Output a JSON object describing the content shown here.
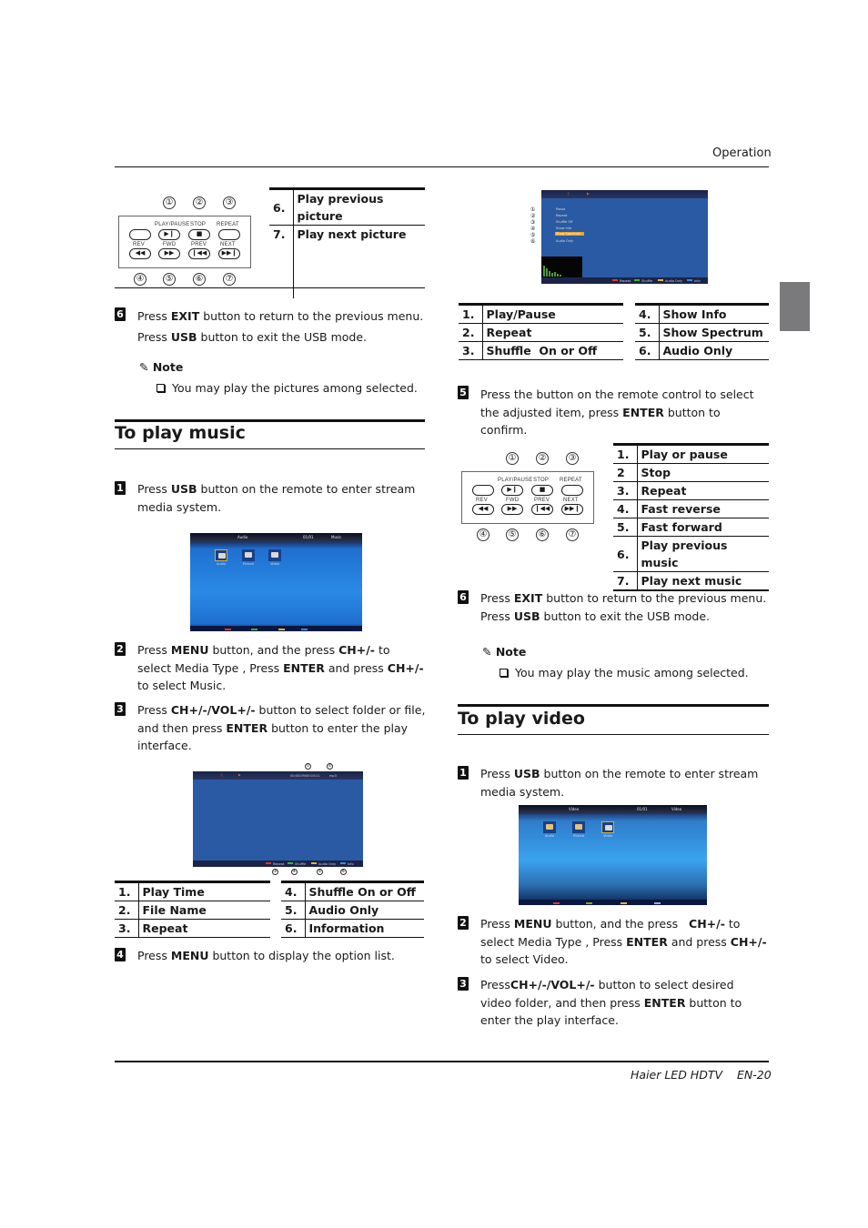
{
  "header": {
    "section": "Operation"
  },
  "footer": {
    "product": "Haier LED HDTV",
    "page": "EN-20"
  },
  "remote_labels": {
    "top_row": [
      "PLAY/PAUSE",
      "STOP",
      "REPEAT"
    ],
    "bottom_row": [
      "REV",
      "FWD",
      "PREV",
      "NEXT"
    ],
    "top_markers": [
      "①",
      "②",
      "③"
    ],
    "bottom_markers": [
      "④",
      "⑤",
      "⑥",
      "⑦"
    ],
    "glyphs": {
      "play_pause": "▶❙",
      "stop": "■",
      "rev": "◀◀",
      "fwd": "▶▶",
      "prev": "❙◀◀",
      "next": "▶▶❙"
    }
  },
  "picture_table": [
    {
      "num": "6.",
      "label": "Play previous picture"
    },
    {
      "num": "7.",
      "label": "Play next picture"
    }
  ],
  "picture_step6": {
    "num": "6",
    "line1_pre": "Press ",
    "line1_bold": "EXIT",
    "line1_post": " button to return to the previous menu.",
    "line2_pre": "Press ",
    "line2_bold": "USB",
    "line2_post": " button to exit the USB mode."
  },
  "picture_note": {
    "title": "Note",
    "item": "You may play the pictures among selected."
  },
  "music": {
    "title": "To play music",
    "step1": {
      "num": "1",
      "pre": "Press ",
      "bold": "USB",
      "post": " button on the remote to enter stream media system."
    },
    "screen1": {
      "top_items": [
        "Audio",
        "01/01",
        "Music"
      ],
      "icons": [
        "Audio",
        "Picture",
        "Video"
      ]
    },
    "step2": {
      "num": "2",
      "t1": "Press ",
      "b1": "MENU",
      "t2": " button, and the press ",
      "b2": "CH+/-",
      "t3": " to select Media Type , Press ",
      "b3": "ENTER",
      "t4": " and press ",
      "b4": "CH+/-",
      "t5": " to select Music."
    },
    "step3": {
      "num": "3",
      "t1": "Press ",
      "b1": "CH+/-/VOL+/-",
      "t2": " button to select folder or file, and then press ",
      "b2": "ENTER",
      "t3": " button to enter the play interface."
    },
    "screen2": {
      "time": "00:00:09/00:03:21",
      "format": "mp3",
      "bottom_keys": [
        "Repeat",
        "Shuffle",
        "Audio Only",
        "Info"
      ],
      "top_markers": [
        "①",
        "②"
      ],
      "bottom_markers": [
        "③",
        "④",
        "⑤",
        "⑥"
      ]
    },
    "info_table_left": [
      {
        "num": "1.",
        "label": "Play Time"
      },
      {
        "num": "2.",
        "label": "File Name"
      },
      {
        "num": "3.",
        "label": "Repeat"
      }
    ],
    "info_table_right": [
      {
        "num": "4.",
        "label": "Shuffle On or Off"
      },
      {
        "num": "5.",
        "label": "Audio Only"
      },
      {
        "num": "6.",
        "label": "Information"
      }
    ],
    "step4": {
      "num": "4",
      "pre": "Press ",
      "bold": "MENU",
      "post": " button to display the option list."
    },
    "screen3": {
      "menu_items": [
        "Pause",
        "Repeat",
        "Shuffle Off",
        "Show Info",
        "Show Spectrum",
        "Audio Only"
      ],
      "menu_markers": [
        "①",
        "②",
        "③",
        "④",
        "⑤",
        "⑥"
      ],
      "bottom_keys": [
        "Repeat",
        "Shuffle",
        "Audio Only",
        "Info"
      ]
    },
    "option_table_left": [
      {
        "num": "1.",
        "label": "Play/Pause"
      },
      {
        "num": "2.",
        "label": "Repeat"
      },
      {
        "num": "3.",
        "label": "Shuffle  On or Off"
      }
    ],
    "option_table_right": [
      {
        "num": "4.",
        "label": "Show Info"
      },
      {
        "num": "5.",
        "label": "Show Spectrum"
      },
      {
        "num": "6.",
        "label": "Audio Only"
      }
    ],
    "step5": {
      "num": "5",
      "t1": "Press the button on the remote control to select the adjusted item, press ",
      "b1": "ENTER",
      "t2": " button to confirm."
    },
    "control_table": [
      {
        "num": "1.",
        "label": "Play or pause"
      },
      {
        "num": "2",
        "label": "Stop"
      },
      {
        "num": "3.",
        "label": "Repeat"
      },
      {
        "num": "4.",
        "label": "Fast reverse"
      },
      {
        "num": "5.",
        "label": "Fast forward"
      },
      {
        "num": "6.",
        "label": "Play previous music"
      },
      {
        "num": "7.",
        "label": "Play next music"
      }
    ],
    "step6": {
      "num": "6",
      "line1_pre": "Press ",
      "line1_bold": "EXIT",
      "line1_post": " button to return to the previous menu.",
      "line2_pre": "Press ",
      "line2_bold": "USB",
      "line2_post": " button to exit the USB mode."
    },
    "note": {
      "title": "Note",
      "item": "You may play the music among selected."
    }
  },
  "video": {
    "title": "To play video",
    "step1": {
      "num": "1",
      "pre": "Press ",
      "bold": "USB",
      "post": " button on the remote to enter stream media system."
    },
    "screen1": {
      "top_items": [
        "Video",
        "01/01",
        "Video"
      ],
      "icons": [
        "Audio",
        "Picture",
        "Video"
      ]
    },
    "step2": {
      "num": "2",
      "t1": "Press ",
      "b1": "MENU",
      "t2": " button, and the press   ",
      "b2": "CH+/-",
      "t3": " to select Media Type , Press ",
      "b3": "ENTER",
      "t4": " and press ",
      "b4": "CH+/-",
      "t5": " to select Video."
    },
    "step3": {
      "num": "3",
      "t1": "Press",
      "b1": "CH+/-/VOL+/-",
      "t2": " button to select desired video folder, and then press ",
      "b2": "ENTER",
      "t3": " button to enter the play interface."
    }
  },
  "colors": {
    "side_tab": "#7a7a7c",
    "screen_blue": "#2a8ae6",
    "highlight": "#e8a22a",
    "red_key": "#d83a2a",
    "green_key": "#3fb13a",
    "yellow_key": "#e3b23a",
    "blue_key": "#3a8ae0"
  }
}
